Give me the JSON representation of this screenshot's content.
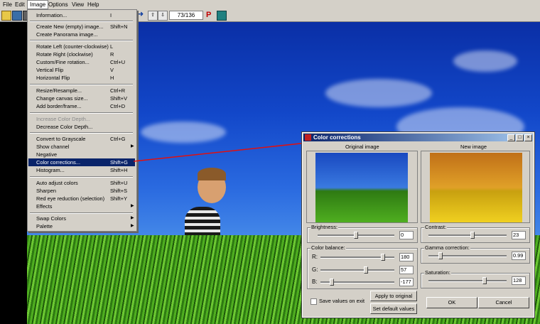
{
  "menubar": {
    "items": [
      "File",
      "Edit",
      "Image",
      "Options",
      "View",
      "Help"
    ]
  },
  "toolbar": {
    "page_counter": "73/136"
  },
  "menu": {
    "items": [
      {
        "label": "Information...",
        "shortcut": "I"
      },
      {
        "label": "Create New (empty) image...",
        "shortcut": "Shift+N"
      },
      {
        "label": "Create Panorama image...",
        "shortcut": ""
      },
      {
        "label": "Rotate Left (counter-clockwise)",
        "shortcut": "L"
      },
      {
        "label": "Rotate Right (clockwise)",
        "shortcut": "R"
      },
      {
        "label": "Custom/Fine rotation...",
        "shortcut": "Ctrl+U"
      },
      {
        "label": "Vertical Flip",
        "shortcut": "V"
      },
      {
        "label": "Horizontal Flip",
        "shortcut": "H"
      },
      {
        "label": "Resize/Resample...",
        "shortcut": "Ctrl+R"
      },
      {
        "label": "Change canvas size...",
        "shortcut": "Shift+V"
      },
      {
        "label": "Add border/frame...",
        "shortcut": "Ctrl+D"
      },
      {
        "label": "Increase Color Depth...",
        "shortcut": "",
        "disabled": true
      },
      {
        "label": "Decrease Color Depth...",
        "shortcut": ""
      },
      {
        "label": "Convert to Grayscale",
        "shortcut": "Ctrl+G"
      },
      {
        "label": "Show channel",
        "shortcut": "",
        "submenu": true
      },
      {
        "label": "Negative",
        "shortcut": ""
      },
      {
        "label": "Color corrections...",
        "shortcut": "Shift+G",
        "selected": true
      },
      {
        "label": "Histogram...",
        "shortcut": "Shift+H"
      },
      {
        "label": "Auto adjust colors",
        "shortcut": "Shift+U"
      },
      {
        "label": "Sharpen",
        "shortcut": "Shift+S"
      },
      {
        "label": "Red eye reduction (selection)",
        "shortcut": "Shift+Y"
      },
      {
        "label": "Effects",
        "shortcut": "",
        "submenu": true
      },
      {
        "label": "Swap Colors",
        "shortcut": "",
        "submenu": true
      },
      {
        "label": "Palette",
        "shortcut": "",
        "submenu": true
      }
    ]
  },
  "dialog": {
    "title": "Color corrections",
    "original_label": "Original image",
    "new_label": "New image",
    "brightness": {
      "label": "Brightness:",
      "value": "0",
      "level": 0.5
    },
    "color_balance": {
      "label": "Color balance:",
      "r": {
        "label": "R:",
        "value": "180",
        "level": 0.85
      },
      "g": {
        "label": "G:",
        "value": "57",
        "level": 0.62
      },
      "b": {
        "label": "B:",
        "value": "-177",
        "level": 0.15
      }
    },
    "contrast": {
      "label": "Contrast:",
      "value": "23",
      "level": 0.56
    },
    "gamma": {
      "label": "Gamma correction:",
      "value": "0.99",
      "level": 0.15
    },
    "saturation": {
      "label": "Saturation:",
      "value": "128",
      "level": 0.72
    },
    "save_on_exit": "Save values on exit",
    "apply_button": "Apply to original",
    "defaults_button": "Set default values",
    "ok_button": "OK",
    "cancel_button": "Cancel"
  }
}
